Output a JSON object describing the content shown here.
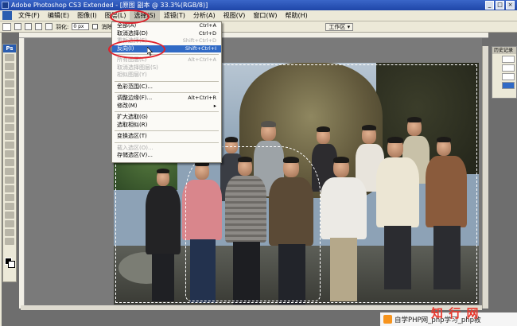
{
  "window": {
    "title": "Adobe Photoshop CS3 Extended - [原图 副本 @ 33.3%(RGB/8)]",
    "controls": [
      "_",
      "□",
      "×"
    ]
  },
  "menubar": {
    "items": [
      "文件(F)",
      "编辑(E)",
      "图像(I)",
      "图层(L)",
      "选择(S)",
      "滤镜(T)",
      "分析(A)",
      "视图(V)",
      "窗口(W)",
      "帮助(H)"
    ],
    "active_index": 4
  },
  "options": {
    "feather_label": "羽化:",
    "feather_value": "0 px",
    "antialias_label": "消除锯齿",
    "workspace_label": "工作区 ▾"
  },
  "select_menu": {
    "items": [
      {
        "label": "全部(A)",
        "shortcut": "Ctrl+A",
        "state": "normal"
      },
      {
        "label": "取消选择(D)",
        "shortcut": "Ctrl+D",
        "state": "normal"
      },
      {
        "label": "重新选择(E)",
        "shortcut": "Shift+Ctrl+D",
        "state": "disabled"
      },
      {
        "label": "反向(I)",
        "shortcut": "Shift+Ctrl+I",
        "state": "highlight"
      },
      {
        "sep": true
      },
      {
        "label": "所有图层(L)",
        "shortcut": "Alt+Ctrl+A",
        "state": "disabled"
      },
      {
        "label": "取消选择图层(S)",
        "shortcut": "",
        "state": "disabled"
      },
      {
        "label": "相似图层(Y)",
        "shortcut": "",
        "state": "disabled"
      },
      {
        "sep": true
      },
      {
        "label": "色彩范围(C)...",
        "shortcut": "",
        "state": "normal"
      },
      {
        "sep": true
      },
      {
        "label": "调整边缘(F)...",
        "shortcut": "Alt+Ctrl+R",
        "state": "normal"
      },
      {
        "label": "修改(M)",
        "shortcut": "▸",
        "state": "normal"
      },
      {
        "sep": true
      },
      {
        "label": "扩大选取(G)",
        "shortcut": "",
        "state": "normal"
      },
      {
        "label": "选取相似(R)",
        "shortcut": "",
        "state": "normal"
      },
      {
        "sep": true
      },
      {
        "label": "变换选区(T)",
        "shortcut": "",
        "state": "normal"
      },
      {
        "sep": true
      },
      {
        "label": "载入选区(O)...",
        "shortcut": "",
        "state": "disabled"
      },
      {
        "label": "存储选区(V)...",
        "shortcut": "",
        "state": "normal"
      }
    ]
  },
  "history_panel": {
    "title": "历史记录"
  },
  "toolbox": {
    "logo": "Ps"
  },
  "watermark": {
    "logo": "知 行 网",
    "text": "自学PHP网_php学习_php教"
  },
  "colors": {
    "highlight": "#316ac5",
    "annotation_red": "#e0202a",
    "titlebar": "#2552b8"
  }
}
